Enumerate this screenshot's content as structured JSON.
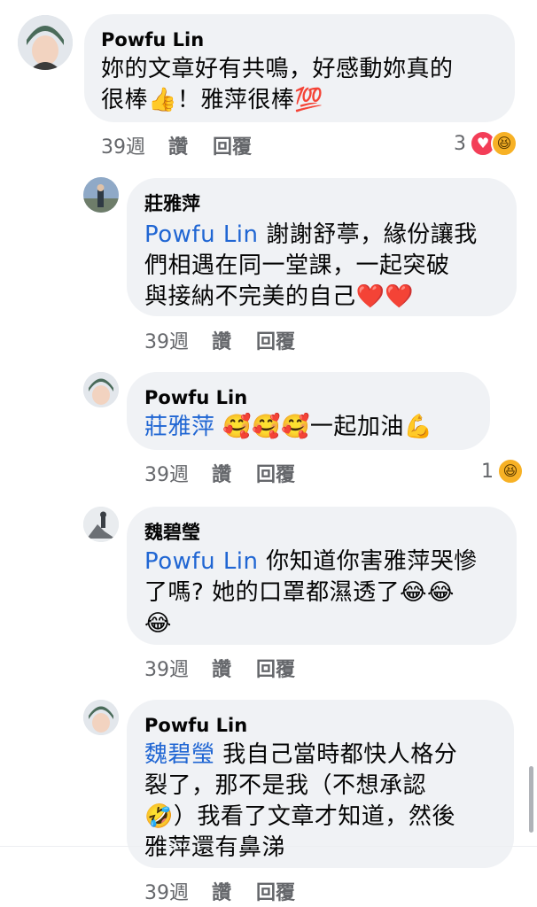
{
  "comments": [
    {
      "author": "Powfu Lin",
      "lines": [
        {
          "tag": "",
          "text": "妳的文章好有共鳴，好感動妳真的"
        },
        {
          "tag": "",
          "text": "很棒👍！雅萍很棒💯"
        }
      ],
      "time": "39週",
      "like_label": "讚",
      "reply_label": "回覆",
      "reaction_count": "3",
      "reactions": [
        "heart-icon",
        "haha-icon"
      ]
    },
    {
      "author": "莊雅萍",
      "lines": [
        {
          "tag": "Powfu Lin",
          "text": " 謝謝舒葶，緣份讓我"
        },
        {
          "tag": "",
          "text": "們相遇在同一堂課，一起突破"
        },
        {
          "tag": "",
          "text": "與接納不完美的自己❤️❤️"
        }
      ],
      "time": "39週",
      "like_label": "讚",
      "reply_label": "回覆"
    },
    {
      "author": "Powfu Lin",
      "lines": [
        {
          "tag": "莊雅萍",
          "text": " 🥰🥰🥰一起加油💪"
        }
      ],
      "time": "39週",
      "like_label": "讚",
      "reply_label": "回覆",
      "reaction_count": "1",
      "reactions": [
        "haha-icon"
      ]
    },
    {
      "author": "魏碧瑩",
      "lines": [
        {
          "tag": "Powfu Lin",
          "text": " 你知道你害雅萍哭慘"
        },
        {
          "tag": "",
          "text": "了嗎? 她的口罩都濕透了😂😂"
        },
        {
          "tag": "",
          "text": "😂"
        }
      ],
      "time": "39週",
      "like_label": "讚",
      "reply_label": "回覆"
    },
    {
      "author": "Powfu Lin",
      "lines": [
        {
          "tag": "魏碧瑩",
          "text": " 我自己當時都快人格分"
        },
        {
          "tag": "",
          "text": "裂了，那不是我（不想承認"
        },
        {
          "tag": "",
          "text": "🤣）我看了文章才知道，然後"
        },
        {
          "tag": "",
          "text": "雅萍還有鼻涕"
        }
      ],
      "time": "39週",
      "like_label": "讚",
      "reply_label": "回覆"
    }
  ],
  "colors": {
    "bubble": "#f0f2f5",
    "tag": "#2066d3",
    "meta": "#65676b",
    "heart": "#f33e58",
    "haha": "#f7b125"
  }
}
